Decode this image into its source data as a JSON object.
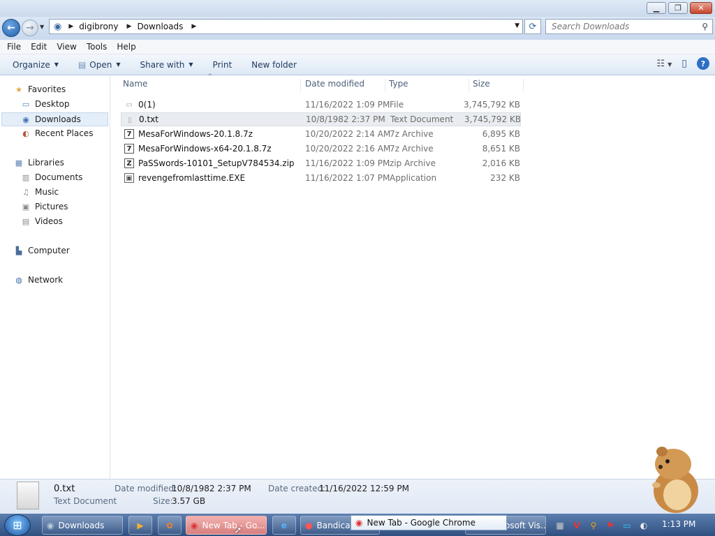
{
  "window": {
    "minimize_icon": "minimize-icon",
    "maximize_icon": "maximize-icon",
    "close_icon": "close-icon"
  },
  "address": {
    "crumbs": [
      "digibrony",
      "Downloads"
    ]
  },
  "search": {
    "placeholder": "Search Downloads"
  },
  "menu": [
    "File",
    "Edit",
    "View",
    "Tools",
    "Help"
  ],
  "toolbar": {
    "organize": "Organize",
    "open": "Open",
    "share": "Share with",
    "print": "Print",
    "new_folder": "New folder"
  },
  "nav": {
    "favorites": "Favorites",
    "desktop": "Desktop",
    "downloads": "Downloads",
    "recent": "Recent Places",
    "libraries": "Libraries",
    "documents": "Documents",
    "music": "Music",
    "pictures": "Pictures",
    "videos": "Videos",
    "computer": "Computer",
    "network": "Network"
  },
  "columns": {
    "name": "Name",
    "date": "Date modified",
    "type": "Type",
    "size": "Size"
  },
  "files": [
    {
      "name": "0(1)",
      "date": "11/16/2022 1:09 PM",
      "type": "File",
      "size": "3,745,792 KB"
    },
    {
      "name": "0.txt",
      "date": "10/8/1982 2:37 PM",
      "type": "Text Document",
      "size": "3,745,792 KB"
    },
    {
      "name": "MesaForWindows-20.1.8.7z",
      "date": "10/20/2022 2:14 AM",
      "type": "7z Archive",
      "size": "6,895 KB"
    },
    {
      "name": "MesaForWindows-x64-20.1.8.7z",
      "date": "10/20/2022 2:16 AM",
      "type": "7z Archive",
      "size": "8,651 KB"
    },
    {
      "name": "PaSSwords-10101_SetupV784534.zip",
      "date": "11/16/2022 1:09 PM",
      "type": "zip Archive",
      "size": "2,016 KB"
    },
    {
      "name": "revengefromlasttime.EXE",
      "date": "11/16/2022 1:07 PM",
      "type": "Application",
      "size": "232 KB"
    }
  ],
  "details": {
    "filename": "0.txt",
    "filetype": "Text Document",
    "date_modified_label": "Date modified:",
    "date_modified": "10/8/1982 2:37 PM",
    "date_created_label": "Date created:",
    "date_created": "11/16/2022 12:59 PM",
    "size_label": "Size:",
    "size": "3.57 GB"
  },
  "taskbar": {
    "downloads": "Downloads",
    "chrome": "New Tab - Go...",
    "bandicam": "Bandicam",
    "vis": "osoft Vis...",
    "tooltip": "New Tab - Google Chrome",
    "clock": "1:13 PM"
  }
}
